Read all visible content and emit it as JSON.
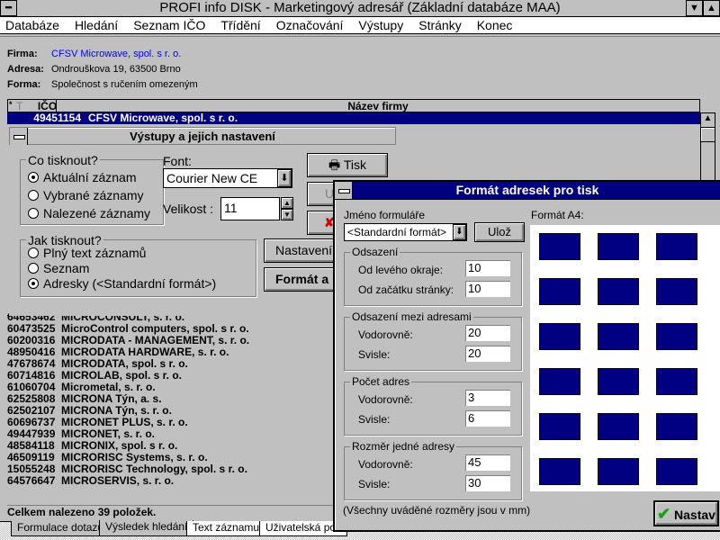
{
  "window": {
    "title": "PROFI info DISK - Marketingový adresář (Základní databáze MAA)"
  },
  "menu": [
    "Databáze",
    "Hledání",
    "Seznam IČO",
    "Třídění",
    "Označování",
    "Výstupy",
    "Stránky",
    "Konec"
  ],
  "info": {
    "firma_label": "Firma:",
    "firma": "CFSV Microwave, spol. s r. o.",
    "adresa_label": "Adresa:",
    "adresa": "Ondrouškova 19, 63500 Brno",
    "forma_label": "Forma:",
    "forma": "Společnost s ručením omezeným"
  },
  "table": {
    "col_star": "*",
    "col_t": "T",
    "col_ico": "IČO",
    "col_name": "Název firmy",
    "selected": {
      "ico": "49451154",
      "name": "CFSV Microwave, spol. s r. o."
    },
    "rows": [
      {
        "ico": "64653462",
        "name": "MICROCONSULT, s. r. o."
      },
      {
        "ico": "60473525",
        "name": "MicroControl computers, spol. s r. o."
      },
      {
        "ico": "60200316",
        "name": "MICRODATA - MANAGEMENT, s. r. o."
      },
      {
        "ico": "48950416",
        "name": "MICRODATA HARDWARE, s. r. o."
      },
      {
        "ico": "47678674",
        "name": "MICRODATA, spol. s r. o."
      },
      {
        "ico": "60714816",
        "name": "MICROLAB, spol. s r. o."
      },
      {
        "ico": "61060704",
        "name": "Micrometal, s. r. o."
      },
      {
        "ico": "62525808",
        "name": "MICRONA Týn, a. s."
      },
      {
        "ico": "62502107",
        "name": "MICRONA Týn, s. r. o."
      },
      {
        "ico": "60696737",
        "name": "MICRONET PLUS, s. r. o."
      },
      {
        "ico": "49447939",
        "name": "MICRONET, s. r. o."
      },
      {
        "ico": "48584118",
        "name": "MICRONIX, spol. s r. o."
      },
      {
        "ico": "46509119",
        "name": "MICRORISC Systems, s. r. o."
      },
      {
        "ico": "15055248",
        "name": "MICRORISC Technology, spol. s r. o."
      },
      {
        "ico": "64576647",
        "name": "MICROSERVIS, s. r. o."
      }
    ]
  },
  "status": "Celkem nalezeno 39 položek.",
  "tabs": [
    "Formulace dotazu",
    "Výsledek hledání",
    "Text záznamu",
    "Uživatelská poz"
  ],
  "vystupy": {
    "title": "Výstupy a jejich nastavení",
    "co_label": "Co tisknout?",
    "co": [
      "Aktuální záznam",
      "Vybrané záznamy",
      "Nalezené záznamy"
    ],
    "font_label": "Font:",
    "font": "Courier New CE",
    "size_label": "Velikost :",
    "size": "11",
    "jak_label": "Jak tisknout?",
    "jak": [
      "Plný text záznamů",
      "Seznam",
      "Adresky (<Standardní formát>)"
    ],
    "tisk": "Tisk",
    "u_btn": "U",
    "cancel": "✘",
    "nastaveni": "Nastavení",
    "format": "Formát a"
  },
  "format_dlg": {
    "title": "Formát adresek pro tisk",
    "jmeno_label": "Jméno formuláře",
    "jmeno": "<Standardní formát>",
    "uloz": "Ulož",
    "odsazeni": {
      "label": "Odsazení",
      "left_label": "Od levého okraje:",
      "left": "10",
      "top_label": "Od začátku stránky:",
      "top": "10"
    },
    "mezi": {
      "label": "Odsazení mezi adresami",
      "h_label": "Vodorovně:",
      "h": "20",
      "v_label": "Svisle:",
      "v": "20"
    },
    "pocet": {
      "label": "Počet adres",
      "h_label": "Vodorovně:",
      "h": "3",
      "v_label": "Svisle:",
      "v": "6"
    },
    "rozmer": {
      "label": "Rozměr jedné adresy",
      "h_label": "Vodorovně:",
      "h": "45",
      "v_label": "Svisle:",
      "v": "30"
    },
    "note": "(Všechny uváděné rozměry jsou v mm)",
    "preview_label": "Formát A4:",
    "nastav": "Nastav",
    "label_color": "#000080"
  }
}
